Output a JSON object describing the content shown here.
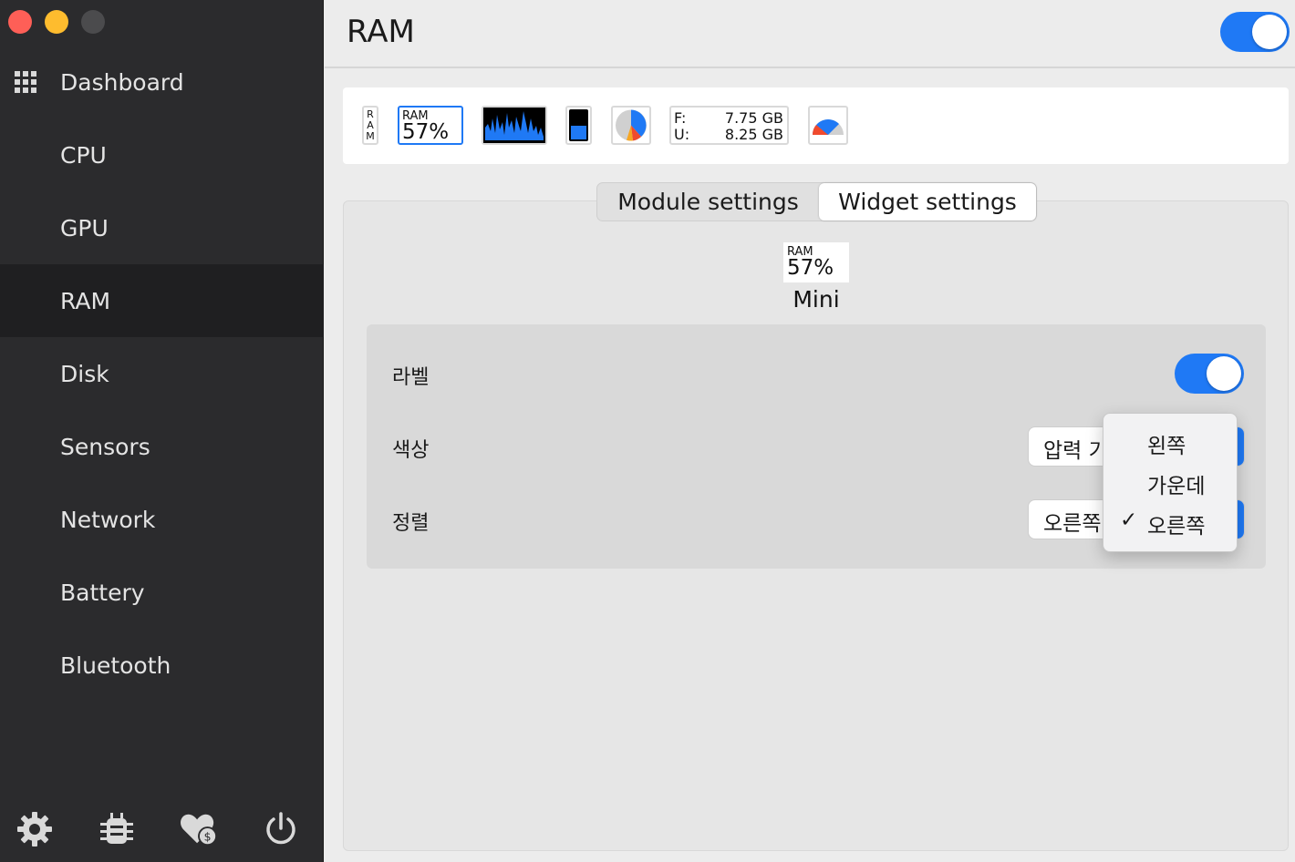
{
  "window": {
    "traffic_lights": [
      "close",
      "minimize",
      "zoom"
    ]
  },
  "sidebar": {
    "items": [
      {
        "label": "Dashboard",
        "icon": "grid-icon"
      },
      {
        "label": "CPU"
      },
      {
        "label": "GPU"
      },
      {
        "label": "RAM",
        "active": true
      },
      {
        "label": "Disk"
      },
      {
        "label": "Sensors"
      },
      {
        "label": "Network"
      },
      {
        "label": "Battery"
      },
      {
        "label": "Bluetooth"
      }
    ],
    "bottom_icons": [
      "gear-icon",
      "bug-icon",
      "heart-donate-icon",
      "power-icon"
    ]
  },
  "header": {
    "title": "RAM",
    "module_enabled": true
  },
  "widgets": {
    "label_widget": "R\nA\nM",
    "mini": {
      "label": "RAM",
      "value": "57%"
    },
    "text_widget": {
      "free_label": "F:",
      "free_value": "7.75 GB",
      "used_label": "U:",
      "used_value": "8.25 GB"
    }
  },
  "tabs": {
    "module": "Module settings",
    "widget": "Widget settings",
    "selected": "widget"
  },
  "preview": {
    "label": "RAM",
    "value": "57%",
    "name": "Mini"
  },
  "settings": {
    "label_row": {
      "label": "라벨",
      "enabled": true
    },
    "color_row": {
      "label": "색상",
      "value": "압력 기반"
    },
    "align_row": {
      "label": "정렬",
      "value": "오른쪽"
    }
  },
  "popup": {
    "options": [
      "왼쪽",
      "가운데",
      "오른쪽"
    ],
    "selected": "오른쪽"
  },
  "colors": {
    "accent": "#1f79f5",
    "sidebar_bg": "#2b2b2d",
    "sidebar_active": "#1f1f21"
  }
}
